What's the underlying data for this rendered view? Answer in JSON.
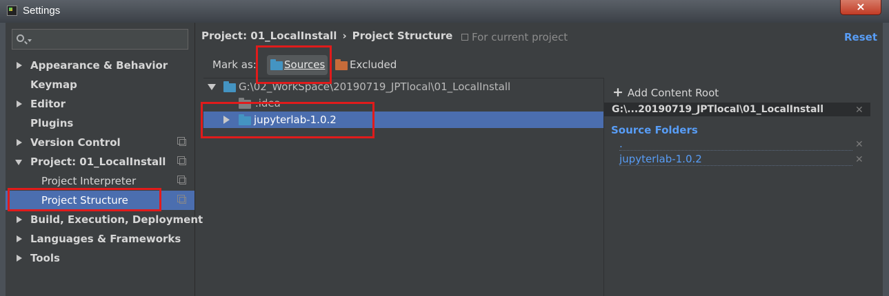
{
  "window": {
    "title": "Settings",
    "close_label": "×"
  },
  "sidebar": {
    "search_placeholder": "",
    "items": [
      {
        "label": "Appearance & Behavior",
        "expander": "collapsed"
      },
      {
        "label": "Keymap"
      },
      {
        "label": "Editor",
        "expander": "collapsed"
      },
      {
        "label": "Plugins"
      },
      {
        "label": "Version Control",
        "expander": "collapsed",
        "project_scope": true
      },
      {
        "label": "Project: 01_LocalInstall",
        "expander": "expanded",
        "project_scope": true
      },
      {
        "label": "Project Interpreter",
        "sub": true,
        "project_scope": true
      },
      {
        "label": "Project Structure",
        "sub": true,
        "selected": true,
        "project_scope": true
      },
      {
        "label": "Build, Execution, Deployment",
        "expander": "collapsed"
      },
      {
        "label": "Languages & Frameworks",
        "expander": "collapsed"
      },
      {
        "label": "Tools",
        "expander": "collapsed"
      }
    ]
  },
  "header": {
    "breadcrumb": [
      "Project: 01_LocalInstall",
      "Project Structure"
    ],
    "breadcrumb_separator": "›",
    "scope_note": "For current project",
    "reset_label": "Reset"
  },
  "mark_as": {
    "label": "Mark as:",
    "sources_label": "Sources",
    "excluded_label": "Excluded"
  },
  "tree": {
    "rows": [
      {
        "label": "G:\\02_WorkSpace\\20190719_JPTlocal\\01_LocalInstall",
        "expanded": true
      },
      {
        "label": ".idea",
        "icon": "folder-grey-icon"
      },
      {
        "label": "jupyterlab-1.0.2",
        "icon": "folder-blue-icon",
        "selected": true,
        "expander": "collapsed"
      }
    ]
  },
  "content_roots": {
    "add_label": "Add Content Root",
    "root_path": "G:\\...20190719_JPTlocal\\01_LocalInstall",
    "source_folders_title": "Source Folders",
    "source_folders": [
      ".",
      "jupyterlab-1.0.2"
    ]
  },
  "colors": {
    "background": "#3c3f41",
    "selection": "#4b6eaf",
    "link_blue": "#589df6",
    "source_folder": "#4494c2",
    "excluded_folder": "#c66b3a",
    "annotation_red": "#e11b1b"
  }
}
